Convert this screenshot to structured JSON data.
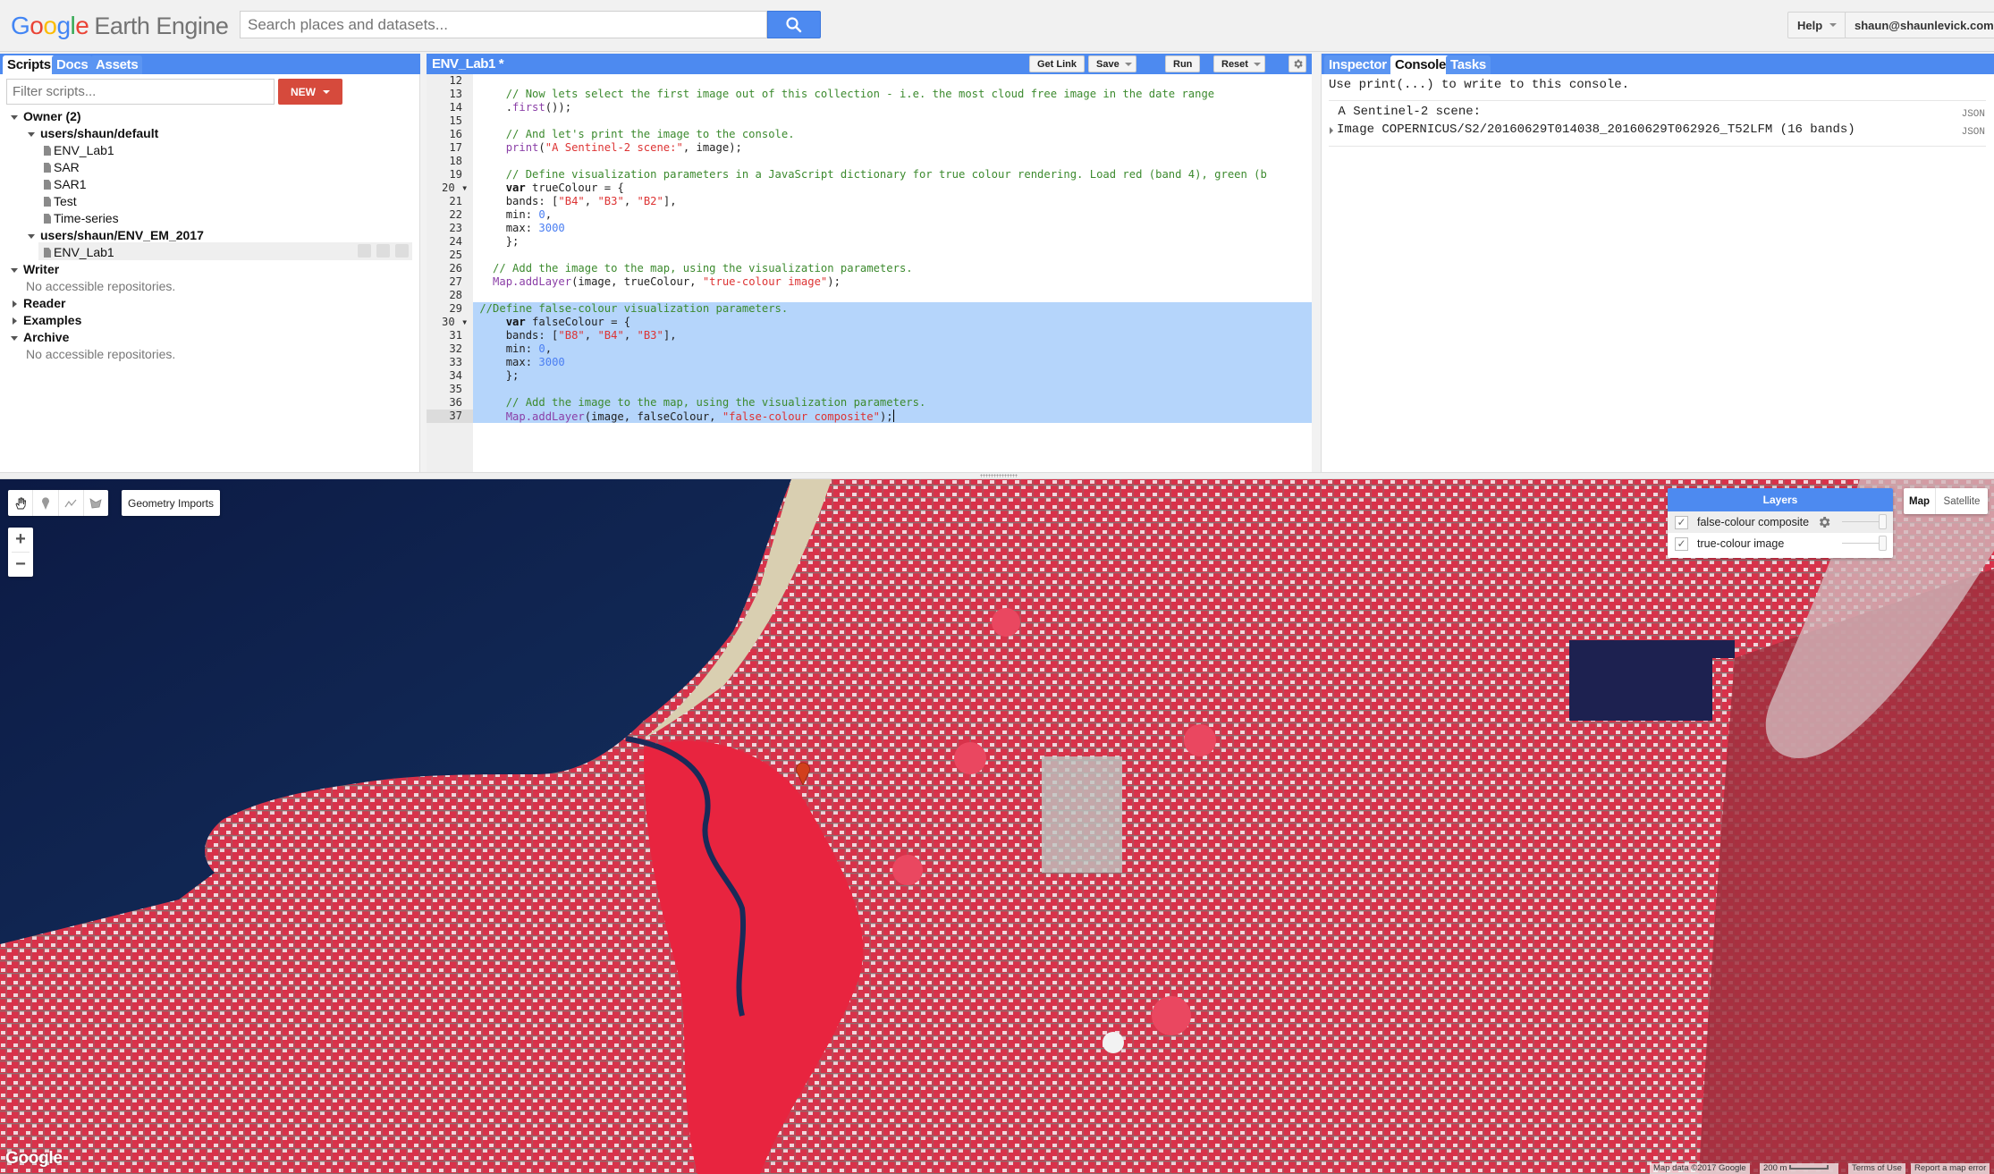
{
  "header": {
    "logo_google": "Google",
    "logo_product": "Earth Engine",
    "search_placeholder": "Search places and datasets...",
    "help_label": "Help",
    "account_label": "shaun@shaunlevick.com"
  },
  "left_panel": {
    "tabs": [
      {
        "label": "Scripts",
        "active": true
      },
      {
        "label": "Docs",
        "active": false
      },
      {
        "label": "Assets",
        "active": false
      }
    ],
    "filter_placeholder": "Filter scripts...",
    "new_label": "NEW",
    "tree": {
      "owner_label": "Owner  (2)",
      "repos": [
        {
          "name": "users/shaun/default",
          "files": [
            "ENV_Lab1",
            "SAR",
            "SAR1",
            "Test",
            "Time-series"
          ]
        },
        {
          "name": "users/shaun/ENV_EM_2017",
          "files": [
            "ENV_Lab1"
          ]
        }
      ],
      "writer_label": "Writer",
      "writer_empty": "No accessible repositories.",
      "reader_label": "Reader",
      "examples_label": "Examples",
      "archive_label": "Archive",
      "archive_empty": "No accessible repositories."
    }
  },
  "editor": {
    "title": "ENV_Lab1 *",
    "buttons": {
      "get_link": "Get Link",
      "save": "Save",
      "run": "Run",
      "reset": "Reset"
    },
    "active_line": 37,
    "selected_lines": [
      29,
      37
    ],
    "lines": [
      {
        "n": "12",
        "tokens": []
      },
      {
        "n": "13",
        "tokens": [
          [
            "cm",
            "    // Now lets select the first image out of this collection - i.e. the most cloud free image in the date range"
          ]
        ]
      },
      {
        "n": "14",
        "tokens": [
          [
            "",
            "    ."
          ],
          [
            "fn",
            "first"
          ],
          [
            "",
            "());"
          ]
        ]
      },
      {
        "n": "15",
        "tokens": []
      },
      {
        "n": "16",
        "tokens": [
          [
            "cm",
            "    // And let's print the image to the console."
          ]
        ]
      },
      {
        "n": "17",
        "tokens": [
          [
            "fn",
            "    print"
          ],
          [
            "",
            "("
          ],
          [
            "str",
            "\"A Sentinel-2 scene:\""
          ],
          [
            "",
            ", image);"
          ]
        ]
      },
      {
        "n": "18",
        "tokens": []
      },
      {
        "n": "19",
        "tokens": [
          [
            "cm",
            "    // Define visualization parameters in a JavaScript dictionary for true colour rendering. Load red (band 4), green (b"
          ]
        ]
      },
      {
        "n": "20",
        "fold": true,
        "tokens": [
          [
            "kw",
            "    var"
          ],
          [
            "",
            " trueColour = {"
          ]
        ]
      },
      {
        "n": "21",
        "tokens": [
          [
            "",
            "    bands: ["
          ],
          [
            "str",
            "\"B4\""
          ],
          [
            "",
            ", "
          ],
          [
            "str",
            "\"B3\""
          ],
          [
            "",
            ", "
          ],
          [
            "str",
            "\"B2\""
          ],
          [
            "",
            "],"
          ]
        ]
      },
      {
        "n": "22",
        "tokens": [
          [
            "",
            "    min: "
          ],
          [
            "num",
            "0"
          ],
          [
            "",
            ","
          ]
        ]
      },
      {
        "n": "23",
        "tokens": [
          [
            "",
            "    max: "
          ],
          [
            "num",
            "3000"
          ]
        ]
      },
      {
        "n": "24",
        "tokens": [
          [
            "",
            "    };"
          ]
        ]
      },
      {
        "n": "25",
        "tokens": []
      },
      {
        "n": "26",
        "tokens": [
          [
            "cm",
            "  // Add the image to the map, using the visualization parameters."
          ]
        ]
      },
      {
        "n": "27",
        "tokens": [
          [
            "fn",
            "  Map.addLayer"
          ],
          [
            "",
            "(image, trueColour, "
          ],
          [
            "str",
            "\"true-colour image\""
          ],
          [
            "",
            ");"
          ]
        ]
      },
      {
        "n": "28",
        "tokens": []
      },
      {
        "n": "29",
        "tokens": [
          [
            "cm",
            "//Define false-colour visualization parameters."
          ]
        ]
      },
      {
        "n": "30",
        "fold": true,
        "tokens": [
          [
            "kw",
            "    var"
          ],
          [
            "",
            " falseColour = {"
          ]
        ]
      },
      {
        "n": "31",
        "tokens": [
          [
            "",
            "    bands: ["
          ],
          [
            "str",
            "\"B8\""
          ],
          [
            "",
            ", "
          ],
          [
            "str",
            "\"B4\""
          ],
          [
            "",
            ", "
          ],
          [
            "str",
            "\"B3\""
          ],
          [
            "",
            "],"
          ]
        ]
      },
      {
        "n": "32",
        "tokens": [
          [
            "",
            "    min: "
          ],
          [
            "num",
            "0"
          ],
          [
            "",
            ","
          ]
        ]
      },
      {
        "n": "33",
        "tokens": [
          [
            "",
            "    max: "
          ],
          [
            "num",
            "3000"
          ]
        ]
      },
      {
        "n": "34",
        "tokens": [
          [
            "",
            "    };"
          ]
        ]
      },
      {
        "n": "35",
        "tokens": []
      },
      {
        "n": "36",
        "tokens": [
          [
            "cm",
            "    // Add the image to the map, using the visualization parameters."
          ]
        ]
      },
      {
        "n": "37",
        "tokens": [
          [
            "fn",
            "    Map.addLayer"
          ],
          [
            "",
            "(image, falseColour, "
          ],
          [
            "str",
            "\"false-colour composite\""
          ],
          [
            "",
            ");"
          ]
        ]
      }
    ]
  },
  "right_panel": {
    "tabs": [
      {
        "label": "Inspector",
        "active": false
      },
      {
        "label": "Console",
        "active": true
      },
      {
        "label": "Tasks",
        "active": false
      }
    ],
    "console_hint": "Use print(...) to write to this console.",
    "entries": [
      {
        "text": " A Sentinel-2 scene:",
        "tag": "JSON",
        "expandable": false
      },
      {
        "text": "Image COPERNICUS/S2/20160629T014038_20160629T062926_T52LFM (16 bands)",
        "tag": "JSON",
        "expandable": true
      }
    ]
  },
  "map": {
    "geometry_imports_label": "Geometry Imports",
    "draw_tools": [
      "hand-pan",
      "point-marker",
      "line",
      "polygon"
    ],
    "zoom_in": "+",
    "zoom_out": "−",
    "layers_title": "Layers",
    "layers": [
      {
        "name": "false-colour composite",
        "checked": true,
        "opacity": 1.0,
        "has_settings": true
      },
      {
        "name": "true-colour image",
        "checked": true,
        "opacity": 1.0,
        "has_settings": false
      }
    ],
    "map_type": {
      "map": "Map",
      "satellite": "Satellite",
      "selected": "Map"
    },
    "watermark": "Google",
    "attribution": "Map data ©2017 Google",
    "scale_label": "200 m",
    "terms": "Terms of Use",
    "report": "Report a map error"
  },
  "colors": {
    "accent_blue": "#4d8af0",
    "new_button_red": "#d64a3c",
    "selection_blue": "#b5d5fb",
    "ocean": "#0e1c48",
    "vegetation_red": "#e8243f"
  }
}
